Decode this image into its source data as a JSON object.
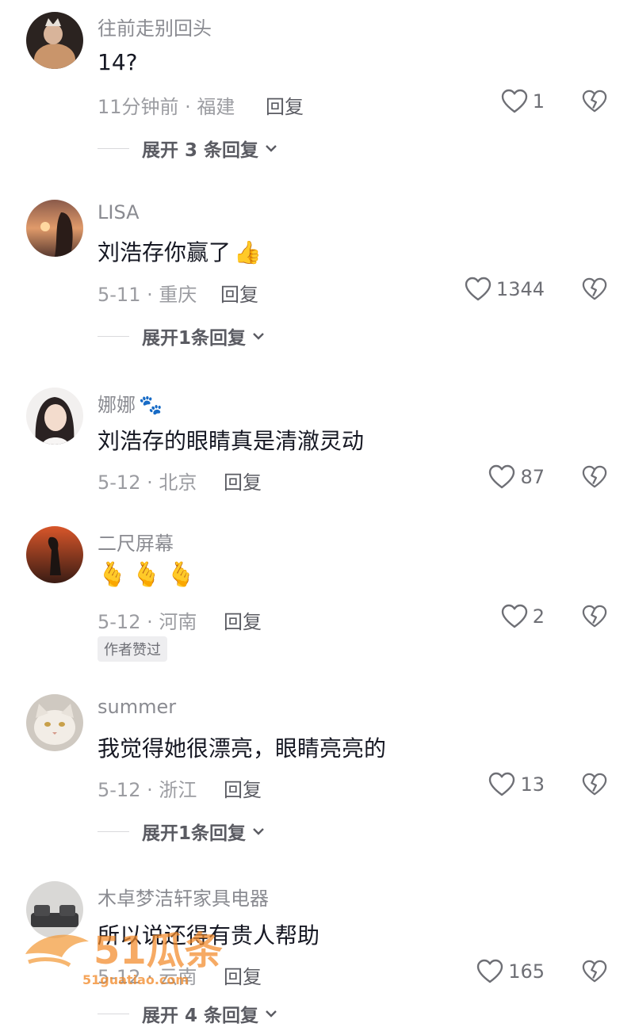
{
  "comments": [
    {
      "username": "往前走别回头",
      "text": "14?",
      "meta": "11分钟前 · 福建",
      "reply_label": "回复",
      "likes": "1",
      "expand_label": "展开 3 条回复"
    },
    {
      "username": "LISA",
      "text": "刘浩存你赢了",
      "emoji": "👍",
      "meta": "5-11 · 重庆",
      "reply_label": "回复",
      "likes": "1344",
      "expand_label": "展开1条回复"
    },
    {
      "username": "娜娜",
      "username_emoji": "🐾",
      "text": "刘浩存的眼睛真是清澈灵动",
      "meta": "5-12 · 北京",
      "reply_label": "回复",
      "likes": "87"
    },
    {
      "username": "二尺屏幕",
      "text": "🫰🫰🫰",
      "meta": "5-12 · 河南",
      "reply_label": "回复",
      "likes": "2",
      "badge": "作者赞过"
    },
    {
      "username": "summer",
      "text": "我觉得她很漂亮，眼睛亮亮的",
      "meta": "5-12 · 浙江",
      "reply_label": "回复",
      "likes": "13",
      "expand_label": "展开1条回复"
    },
    {
      "username": "木卓梦洁轩家具电器",
      "text": "所以说还得有贵人帮助",
      "meta": "5-12 · 云南",
      "reply_label": "回复",
      "likes": "165",
      "expand_label": "展开 4 条回复"
    }
  ],
  "watermark": {
    "brand": "51瓜条",
    "url": "51guatiao.com"
  },
  "colors": {
    "text": "#161823",
    "secondary": "#8a8b91",
    "icon": "#6e6f75"
  }
}
